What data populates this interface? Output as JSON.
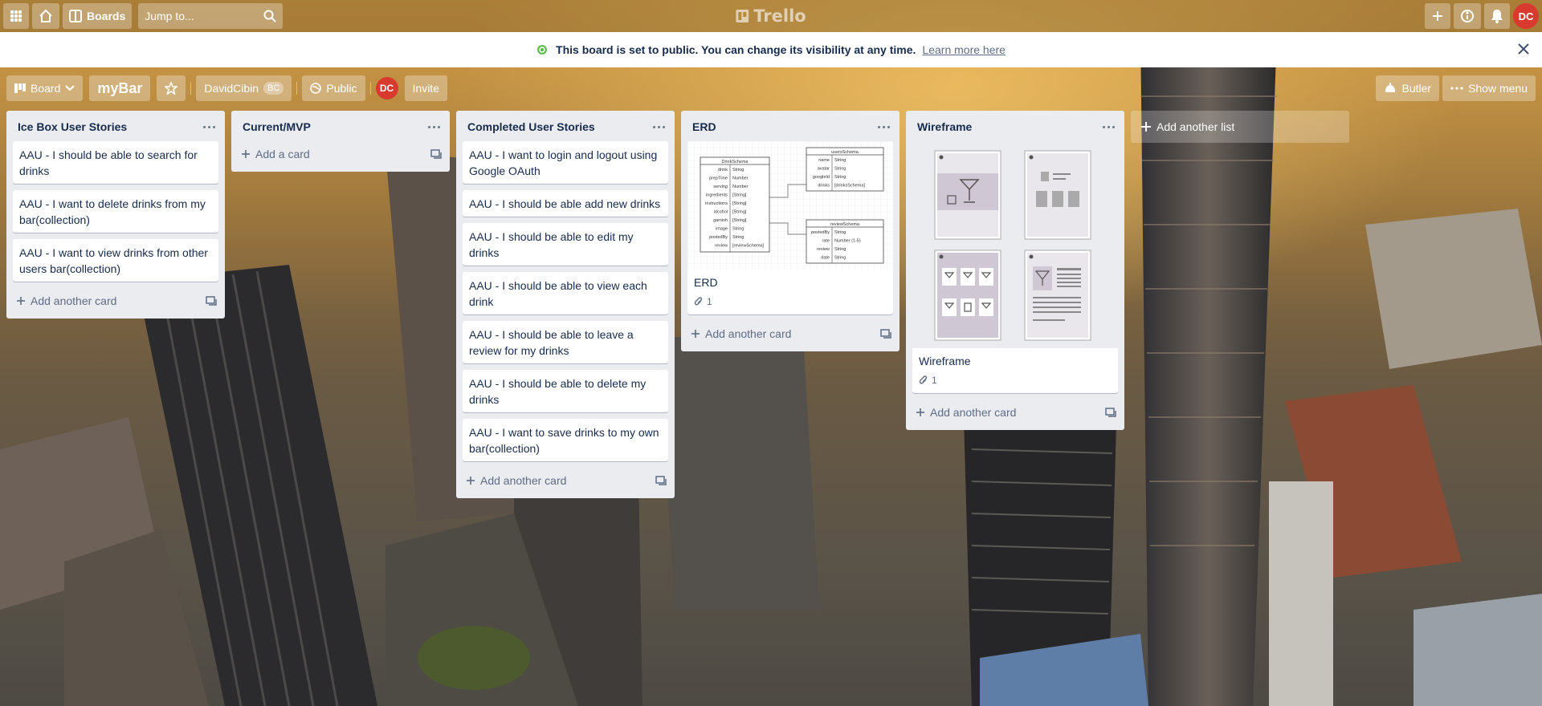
{
  "header": {
    "boards_label": "Boards",
    "search_placeholder": "Jump to...",
    "logo_text": "Trello",
    "user_initials": "DC"
  },
  "notice": {
    "text": "This board is set to public. You can change its visibility at any time.",
    "link": "Learn more here"
  },
  "board_header": {
    "view_label": "Board",
    "board_name": "myBar",
    "team_name": "DavidCibin",
    "team_badge": "BC",
    "visibility": "Public",
    "member_initials": "DC",
    "invite_label": "Invite",
    "butler_label": "Butler",
    "show_menu_label": "Show menu"
  },
  "lists": [
    {
      "title": "Ice Box User Stories",
      "cards": [
        "AAU - I should be able to search for drinks",
        "AAU - I want to delete drinks from my bar(collection)",
        "AAU - I want to view drinks from other users bar(collection)"
      ],
      "add_label": "Add another card"
    },
    {
      "title": "Current/MVP",
      "cards": [],
      "add_label": "Add a card"
    },
    {
      "title": "Completed User Stories",
      "cards": [
        "AAU - I want to login and logout using Google OAuth",
        "AAU - I should be able add new drinks",
        "AAU - I should be able to edit my drinks",
        "AAU - I should be able to view each drink",
        "AAU - I should be able to leave a review for my drinks",
        "AAU - I should be able to delete my drinks",
        "AAU - I want to save drinks to my own bar(collection)"
      ],
      "add_label": "Add another card"
    },
    {
      "title": "ERD",
      "image_cards": [
        {
          "title": "ERD",
          "attachments": "1"
        }
      ],
      "add_label": "Add another card"
    },
    {
      "title": "Wireframe",
      "image_cards": [
        {
          "title": "Wireframe",
          "attachments": "1"
        }
      ],
      "add_label": "Add another card"
    }
  ],
  "add_list_label": "Add another list",
  "erd": {
    "drink_title": "DrinkSchema",
    "drink_fields": [
      "drink",
      "prepTime",
      "serving",
      "ingredients",
      "instructions",
      "alcohol",
      "garnish",
      "image",
      "postedBy",
      "review"
    ],
    "drink_types": [
      "String",
      "Number",
      "Number",
      "[String]",
      "[String]",
      "[String]",
      "[String]",
      "String",
      "String",
      "[reviewSchema]"
    ],
    "users_title": "usersSchema",
    "users_fields": [
      "name",
      "avatar",
      "googleId",
      "drinks"
    ],
    "users_types": [
      "String",
      "String",
      "String",
      "[drinksSchema]"
    ],
    "review_title": "reviewSchema",
    "review_fields": [
      "postedBy",
      "rate",
      "review",
      "date"
    ],
    "review_types": [
      "String",
      "Number (1-5)",
      "String",
      "String"
    ]
  },
  "colors": {
    "list_bg": "#ebecf0",
    "avatar": "#d93a2f",
    "banner_icon": "#61bd4f"
  }
}
